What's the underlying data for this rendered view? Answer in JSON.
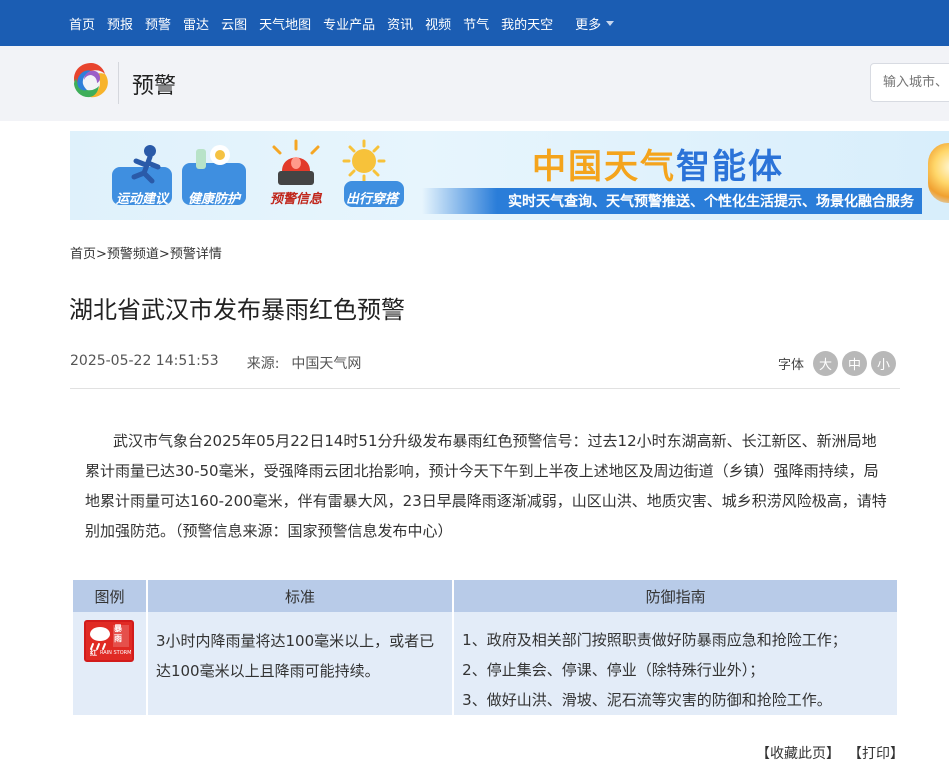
{
  "nav": {
    "items": [
      "首页",
      "预报",
      "预警",
      "雷达",
      "云图",
      "天气地图",
      "专业产品",
      "资讯",
      "视频",
      "节气",
      "我的天空"
    ],
    "more": "更多"
  },
  "header": {
    "section": "预警",
    "search_placeholder": "输入城市、"
  },
  "banner": {
    "cards": [
      "运动建议",
      "健康防护",
      "预警信息",
      "出行穿搭"
    ],
    "title_a": "中国天气",
    "title_b": "智能体",
    "subtitle": "实时天气查询、天气预警推送、个性化生活提示、场景化融合服务"
  },
  "breadcrumb": [
    "首页",
    " >预警频道",
    " >预警详情"
  ],
  "article": {
    "title": "湖北省武汉市发布暴雨红色预警",
    "datetime": "2025-05-22 14:51:53",
    "source_label": "来源:",
    "source": "中国天气网",
    "fontsize_label": "字体",
    "fontsize_options": [
      "大",
      "中",
      "小"
    ],
    "body": "武汉市气象台2025年05月22日14时51分升级发布暴雨红色预警信号：过去12小时东湖高新、长江新区、新洲局地累计雨量已达30-50毫米，受强降雨云团北抬影响，预计今天下午到上半夜上述地区及周边街道（乡镇）强降雨持续，局地累计雨量可达160-200毫米，伴有雷暴大风，23日早晨降雨逐渐减弱，山区山洪、地质灾害、城乡积涝风险极高，请特别加强防范。（预警信息来源：国家预警信息发布中心）"
  },
  "table": {
    "headers": [
      "图例",
      "标准",
      "防御指南"
    ],
    "icon": {
      "cn": "暴雨",
      "level": "红",
      "en": "RAIN STORM"
    },
    "standard": "3小时内降雨量将达100毫米以上，或者已达100毫米以上且降雨可能持续。",
    "guide": [
      "1、政府及相关部门按照职责做好防暴雨应急和抢险工作；",
      "2、停止集会、停课、停业（除特殊行业外）；",
      "3、做好山洪、滑坡、泥石流等灾害的防御和抢险工作。"
    ]
  },
  "footer": {
    "bookmark": "【收藏此页】",
    "print": "【打印】"
  },
  "colors": {
    "nav_bg": "#1b5db3",
    "header_bg": "#f2f3f7",
    "table_head": "#b8cbe8",
    "table_cell": "#e3ecf8",
    "warning_red": "#e02a24"
  }
}
